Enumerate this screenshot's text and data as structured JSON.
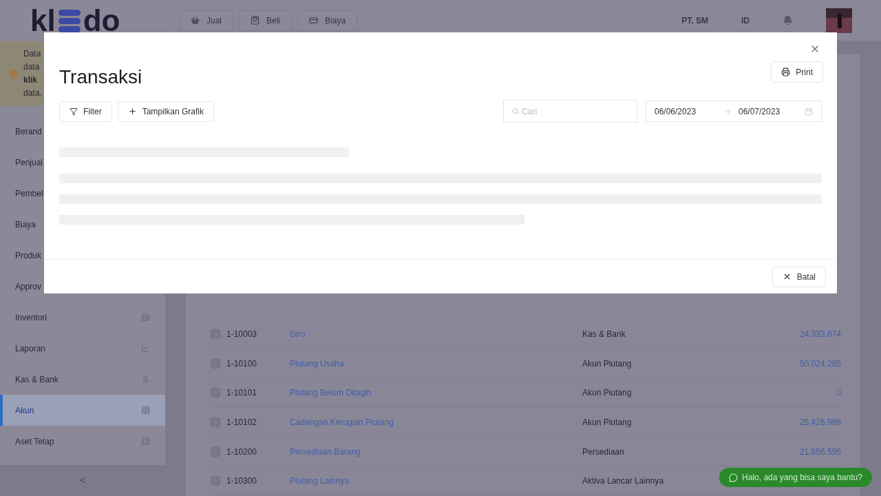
{
  "logo": {
    "left": "kl",
    "right": "do"
  },
  "topbar": {
    "buttons": [
      {
        "label": "Jual"
      },
      {
        "label": "Beli"
      },
      {
        "label": "Biaya"
      }
    ],
    "company": "PT. SM",
    "language": "ID"
  },
  "notice": {
    "lines": [
      "Data",
      "data",
      "**klik**",
      "data."
    ]
  },
  "sidebar": {
    "items": [
      {
        "label": "Berand",
        "selected": false
      },
      {
        "label": "Penjual",
        "selected": false
      },
      {
        "label": "Pembel",
        "selected": false
      },
      {
        "label": "Biaya",
        "selected": false
      },
      {
        "label": "Produk",
        "selected": false
      },
      {
        "label": "Approv",
        "selected": false
      },
      {
        "label": "Inventori",
        "selected": false
      },
      {
        "label": "Laporan",
        "selected": false
      },
      {
        "label": "Kas & Bank",
        "selected": false
      },
      {
        "label": "Akun",
        "selected": true
      },
      {
        "label": "Aset Tetap",
        "selected": false
      }
    ],
    "collapse": "<"
  },
  "table": {
    "rows": [
      {
        "checked": false,
        "code": "1-10003",
        "name": "Giro",
        "category": "Kas & Bank",
        "balance": "24.333.874"
      },
      {
        "checked": false,
        "code": "1-10100",
        "name": "Piutang Usaha",
        "category": "Akun Piutang",
        "balance": "50.024.265"
      },
      {
        "checked": false,
        "code": "1-10101",
        "name": "Piutang Belum Ditagih",
        "category": "Akun Piutang",
        "balance": "0"
      },
      {
        "checked": false,
        "code": "1-10102",
        "name": "Cadangan Kerugian Piutang",
        "category": "Akun Piutang",
        "balance": "25.426.986"
      },
      {
        "checked": false,
        "code": "1-10200",
        "name": "Persediaan Barang",
        "category": "Persediaan",
        "balance": "21.656.595"
      },
      {
        "checked": false,
        "code": "1-10300",
        "name": "Piutang Lainnya",
        "category": "Aktiva Lancar Lainnya"
      }
    ]
  },
  "chat": {
    "label": "Halo, ada yang bisa saya bantu?"
  },
  "modal": {
    "title": "Transaksi",
    "print": "Print",
    "filter": "Filter",
    "show_chart": "Tampilkan Grafik",
    "search": {
      "placeholder": "Cari"
    },
    "date_from": "06/06/2023",
    "date_to": "06/07/2023",
    "cancel": "Batal"
  }
}
